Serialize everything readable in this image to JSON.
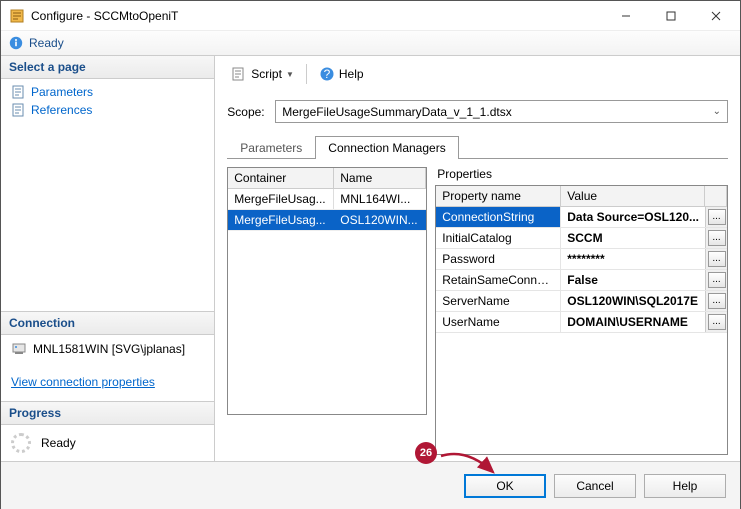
{
  "window": {
    "title": "Configure - SCCMtoOpeniT"
  },
  "status": {
    "text": "Ready"
  },
  "sidebar": {
    "select_page": "Select a page",
    "items": [
      {
        "label": "Parameters"
      },
      {
        "label": "References"
      }
    ],
    "connection_header": "Connection",
    "connection_value": "MNL1581WIN [SVG\\jplanas]",
    "link": "View connection properties",
    "progress_header": "Progress",
    "progress_text": "Ready"
  },
  "toolbar": {
    "script": "Script",
    "help": "Help"
  },
  "scope": {
    "label": "Scope:",
    "value": "MergeFileUsageSummaryData_v_1_1.dtsx"
  },
  "tabs": [
    {
      "label": "Parameters"
    },
    {
      "label": "Connection Managers"
    }
  ],
  "conn_grid": {
    "headers": {
      "c1": "Container",
      "c2": "Name"
    },
    "rows": [
      {
        "c1": "MergeFileUsag...",
        "c2": "MNL164WI..."
      },
      {
        "c1": "MergeFileUsag...",
        "c2": "OSL120WIN..."
      }
    ]
  },
  "properties": {
    "title": "Properties",
    "headers": {
      "c1": "Property name",
      "c2": "Value"
    },
    "rows": [
      {
        "name": "ConnectionString",
        "value": "Data Source=OSL120..."
      },
      {
        "name": "InitialCatalog",
        "value": "SCCM"
      },
      {
        "name": "Password",
        "value": "********"
      },
      {
        "name": "RetainSameConnec...",
        "value": "False"
      },
      {
        "name": "ServerName",
        "value": "OSL120WIN\\SQL2017E"
      },
      {
        "name": "UserName",
        "value": "DOMAIN\\USERNAME"
      }
    ]
  },
  "footer": {
    "ok": "OK",
    "cancel": "Cancel",
    "help": "Help"
  },
  "annotation": {
    "number": "26"
  }
}
